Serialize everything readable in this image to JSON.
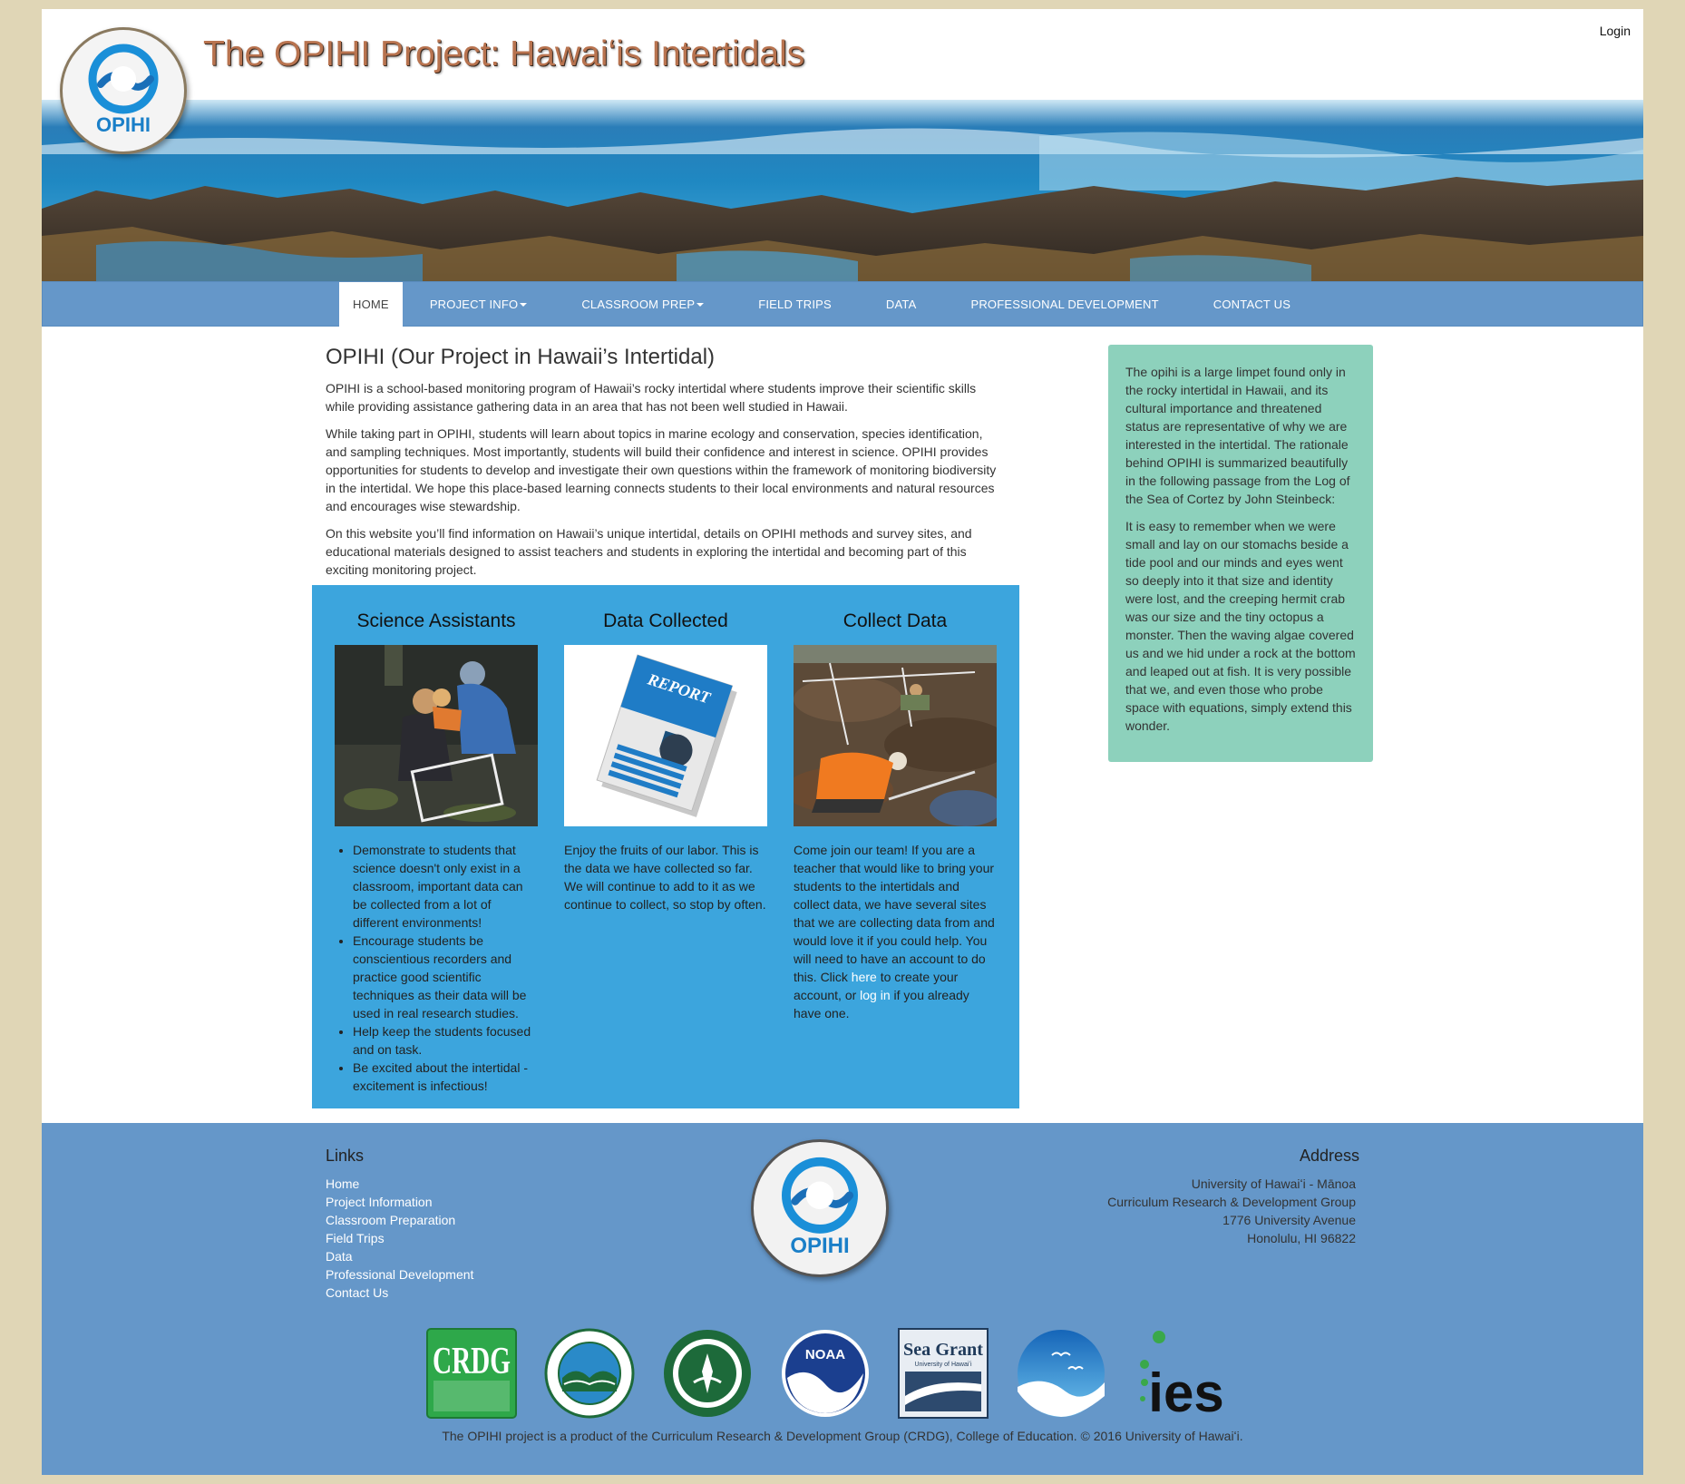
{
  "site": {
    "title": "The OPIHI Project: Hawaiʻis Intertidals",
    "login": "Login",
    "logo_text": "OPIHI"
  },
  "nav": {
    "items": [
      {
        "label": "HOME"
      },
      {
        "label": "PROJECT INFO"
      },
      {
        "label": "CLASSROOM PREP"
      },
      {
        "label": "FIELD TRIPS"
      },
      {
        "label": "DATA"
      },
      {
        "label": "PROFESSIONAL DEVELOPMENT"
      },
      {
        "label": "CONTACT US"
      }
    ]
  },
  "intro": {
    "heading": "OPIHI (Our Project in Hawaii’s Intertidal)",
    "p1": "OPIHI is a school-based monitoring program of Hawaii’s rocky intertidal where students improve their scientific skills while providing assistance gathering data in an area that has not been well studied in Hawaii.",
    "p2": "While taking part in OPIHI, students will learn about topics in marine ecology and conservation, species identification, and sampling techniques. Most importantly, students will build their confidence and interest in science. OPIHI provides opportunities for students to develop and investigate their own questions within the framework of monitoring biodiversity in the intertidal. We hope this place-based learning connects students to their local environments and natural resources and encourages wise stewardship.",
    "p3": "On this website you’ll find information on Hawaii’s unique intertidal, details on OPIHI methods and survey sites, and educational materials designed to assist teachers and students in exploring the intertidal and becoming part of this exciting monitoring project."
  },
  "features": {
    "science": {
      "title": "Science Assistants",
      "bullets": [
        "Demonstrate to students that science doesn't only exist in a classroom, important data can be collected from a lot of different environments!",
        "Encourage students be conscientious recorders and practice good scientific techniques as their data will be used in real research studies.",
        "Help keep the students focused and on task.",
        "Be excited about the intertidal - excitement is infectious!"
      ]
    },
    "data": {
      "title": "Data Collected",
      "report_label": "REPORT",
      "text": "Enjoy the fruits of our labor. This is the data we have collected so far. We will continue to add to it as we continue to collect, so stop by often."
    },
    "collect": {
      "title": "Collect Data",
      "text_a": "Come join our team! If you are a teacher that would like to bring your students to the intertidals and collect data, we have several sites that we are collecting data from and would love it if you could help. You will need to have an account to do this. Click ",
      "link_here": "here",
      "text_b": " to create your account, or ",
      "link_login": "log in",
      "text_c": " if you already have one."
    }
  },
  "sidebar": {
    "p1": "The opihi is a large limpet found only in the rocky intertidal in Hawaii, and its cultural importance and threatened status are representative of why we are interested in the intertidal. The rationale behind OPIHI is summarized beautifully in the following passage from the Log of the Sea of Cortez by John Steinbeck:",
    "p2": "It is easy to remember when we were small and lay on our stomachs beside a tide pool and our minds and eyes went so deeply into it that size and identity were lost, and the creeping hermit crab was our size and the tiny octopus a monster. Then the waving algae covered us and we hid under a rock at the bottom and leaped out at fish. It is very possible that we, and even those who probe space with equations, simply extend this wonder."
  },
  "footer": {
    "links_heading": "Links",
    "links": [
      {
        "label": "Home"
      },
      {
        "label": "Project Information"
      },
      {
        "label": "Classroom Preparation"
      },
      {
        "label": "Field Trips"
      },
      {
        "label": "Data"
      },
      {
        "label": "Professional Development"
      },
      {
        "label": "Contact Us"
      }
    ],
    "address_heading": "Address",
    "address": [
      "University of Hawaiʻi - Mānoa",
      "Curriculum Research & Development Group",
      "1776 University Avenue",
      "Honolulu, HI 96822"
    ],
    "partners": {
      "crdg": "CRDG",
      "noaa": "NOAA",
      "seagrant": "Sea Grant",
      "seagrant_sub": "University of Hawaiʻi",
      "ies": "ies"
    },
    "copyright": "The OPIHI project is a product of the Curriculum Research & Development Group (CRDG), College of Education. © 2016 University of Hawaiʻi."
  },
  "colors": {
    "nav": "#6597c9",
    "feature_panel": "#3ca5dd",
    "sidebar": "#8dd1bc",
    "background": "#e0d6b6",
    "title": "#b8734f"
  }
}
